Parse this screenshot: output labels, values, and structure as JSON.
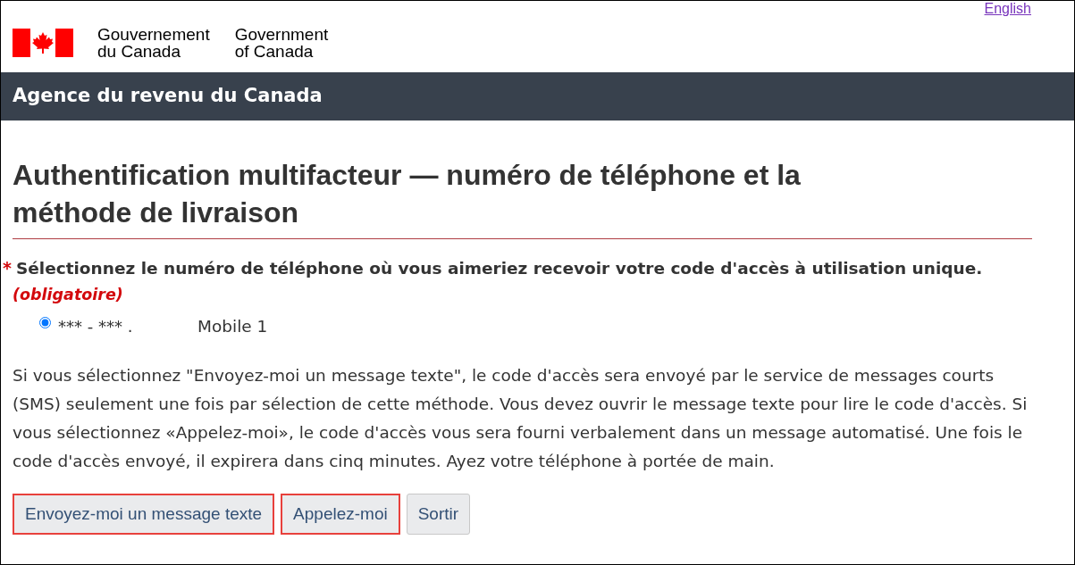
{
  "language_link": "English",
  "signature": [
    {
      "lines": [
        "Gouvernement",
        "du Canada"
      ]
    },
    {
      "lines": [
        "Government",
        "of Canada"
      ]
    }
  ],
  "agency_bar": {
    "title": "Agence du revenu du Canada"
  },
  "page_title": "Authentification multifacteur — numéro de téléphone et la méthode de livraison",
  "question": {
    "required_mark": "*",
    "label": "Sélectionnez le numéro de téléphone où vous aimeriez recevoir votre code d'accès à utilisation unique.",
    "required_note": "(obligatoire)"
  },
  "phone_options": [
    {
      "number": "*** - *** .",
      "label": "Mobile 1",
      "selected": true
    }
  ],
  "instructions": "Si vous sélectionnez \"Envoyez-moi un message texte\", le code d'accès sera envoyé par le service de messages courts (SMS) seulement une fois par sélection de cette méthode. Vous devez ouvrir le message texte pour lire le code d'accès. Si vous sélectionnez «Appelez-moi», le code d'accès vous sera fourni verbalement dans un message automatisé. Une fois le code d'accès envoyé, il expirera dans cinq minutes. Ayez votre téléphone à portée de main.",
  "buttons": [
    {
      "label": "Envoyez-moi un message texte",
      "highlighted": true
    },
    {
      "label": "Appelez-moi",
      "highlighted": true
    },
    {
      "label": "Sortir",
      "highlighted": false
    }
  ]
}
